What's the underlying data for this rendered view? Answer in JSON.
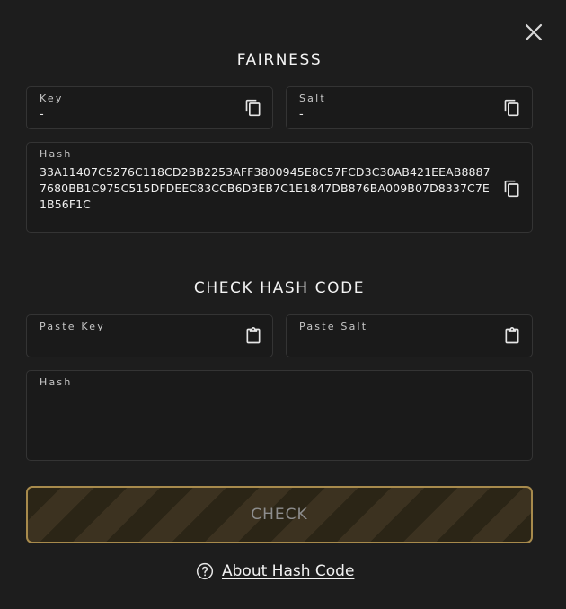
{
  "dialog": {
    "close_icon": "close-icon"
  },
  "fairness": {
    "title": "FAIRNESS",
    "key": {
      "label": "Key",
      "value": "-",
      "icon": "copy-icon"
    },
    "salt": {
      "label": "Salt",
      "value": "-",
      "icon": "copy-icon"
    },
    "hash": {
      "label": "Hash",
      "value": "33A11407C5276C118CD2BB2253AFF3800945E8C57FCD3C30AB421EEAB88877680BB1C975C515DFDEEC83CCB6D3EB7C1E1847DB876BA009B07D8337C7E1B56F1C",
      "icon": "copy-icon"
    }
  },
  "check_hash": {
    "title": "CHECK HASH CODE",
    "paste_key": {
      "label": "Paste Key",
      "value": "",
      "icon": "paste-icon"
    },
    "paste_salt": {
      "label": "Paste Salt",
      "value": "",
      "icon": "paste-icon"
    },
    "hash": {
      "label": "Hash",
      "value": ""
    },
    "check_button_label": "CHECK",
    "about_link": {
      "label": "About Hash Code",
      "icon": "help-circle-icon"
    }
  },
  "colors": {
    "background": "#1d1d1d",
    "field_border": "#343434",
    "button_border": "#a78a4c",
    "button_stripe_dark": "#2b2516",
    "button_stripe_light": "#3c3220",
    "button_text": "#8d8d8d"
  }
}
